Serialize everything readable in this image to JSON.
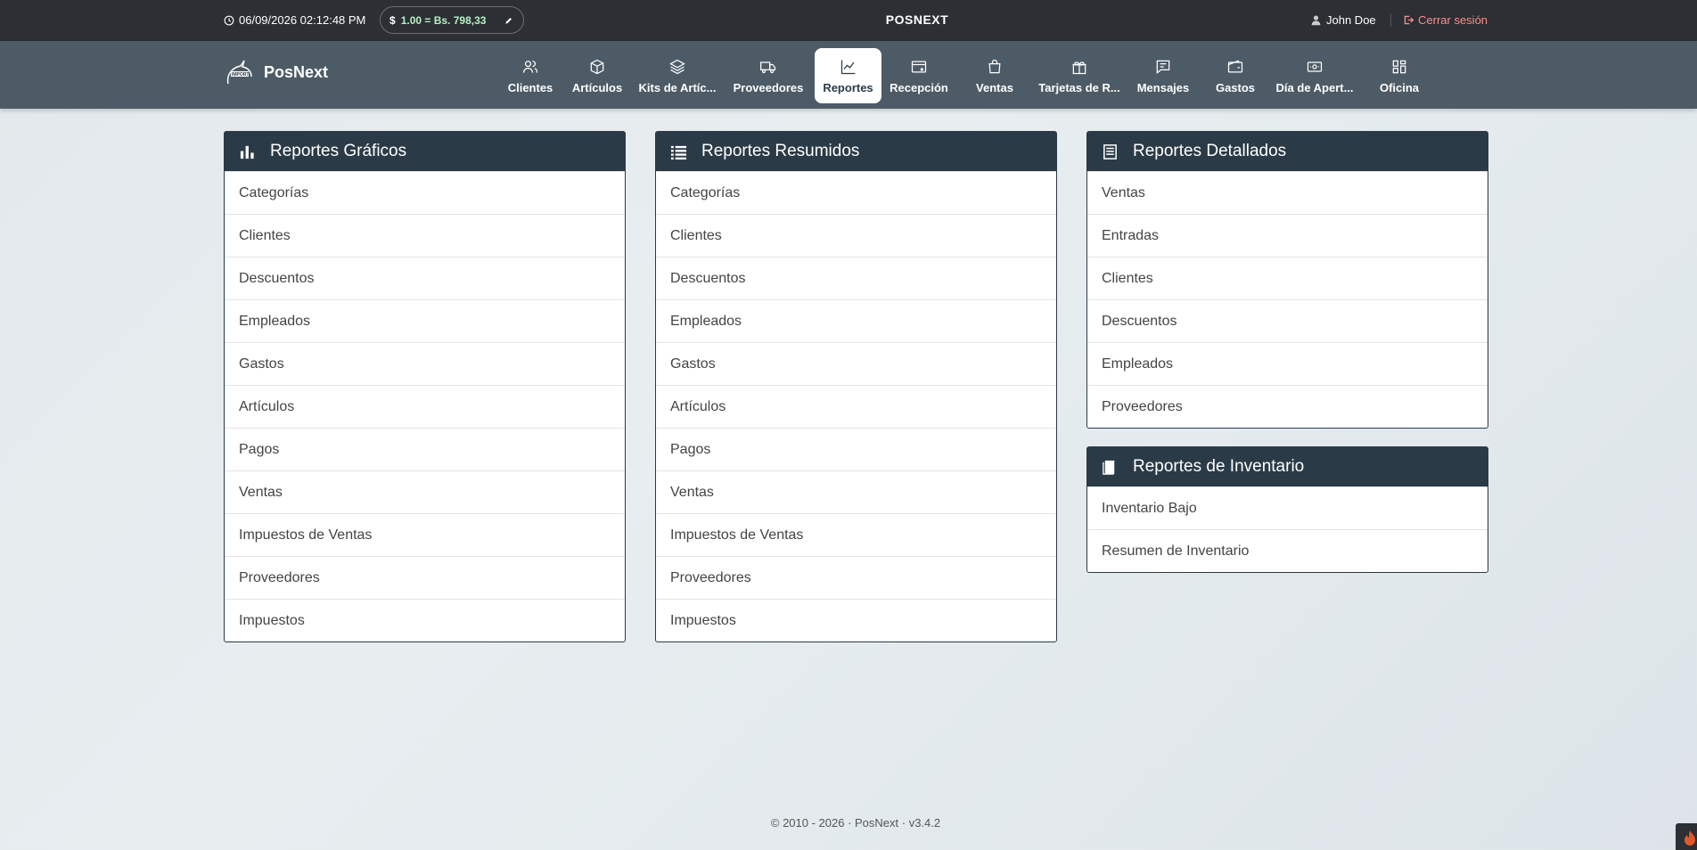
{
  "topbar": {
    "datetime": "06/09/2026 02:12:48 PM",
    "currency_symbol": "$",
    "exchange_rate": "1.00 = Bs. 798,33",
    "brand": "POSNEXT",
    "user_name": "John Doe",
    "logout_label": "Cerrar sesión"
  },
  "navbar": {
    "logo_text": "PosNext",
    "items": [
      {
        "label": "Clientes",
        "icon": "users-icon"
      },
      {
        "label": "Artículos",
        "icon": "box-icon"
      },
      {
        "label": "Kits de Artíc...",
        "icon": "layers-icon"
      },
      {
        "label": "Proveedores",
        "icon": "truck-icon"
      },
      {
        "label": "Reportes",
        "icon": "chart-line-icon",
        "active": true
      },
      {
        "label": "Recepción",
        "icon": "inbox-icon"
      },
      {
        "label": "Ventas",
        "icon": "shopping-bag-icon"
      },
      {
        "label": "Tarjetas de R...",
        "icon": "gift-icon"
      },
      {
        "label": "Mensajes",
        "icon": "message-icon"
      },
      {
        "label": "Gastos",
        "icon": "wallet-icon"
      },
      {
        "label": "Día de Apert...",
        "icon": "cash-icon"
      },
      {
        "label": "Oficina",
        "icon": "grid-icon"
      }
    ]
  },
  "panels": {
    "graficos": {
      "title": "Reportes Gráficos",
      "icon": "bar-chart-icon",
      "items": [
        "Categorías",
        "Clientes",
        "Descuentos",
        "Empleados",
        "Gastos",
        "Artículos",
        "Pagos",
        "Ventas",
        "Impuestos de Ventas",
        "Proveedores",
        "Impuestos"
      ]
    },
    "resumidos": {
      "title": "Reportes Resumidos",
      "icon": "list-icon",
      "items": [
        "Categorías",
        "Clientes",
        "Descuentos",
        "Empleados",
        "Gastos",
        "Artículos",
        "Pagos",
        "Ventas",
        "Impuestos de Ventas",
        "Proveedores",
        "Impuestos"
      ]
    },
    "detallados": {
      "title": "Reportes Detallados",
      "icon": "document-list-icon",
      "items": [
        "Ventas",
        "Entradas",
        "Clientes",
        "Descuentos",
        "Empleados",
        "Proveedores"
      ]
    },
    "inventario": {
      "title": "Reportes de Inventario",
      "icon": "book-icon",
      "items": [
        "Inventario Bajo",
        "Resumen de Inventario"
      ]
    }
  },
  "footer": {
    "text": "© 2010 - 2026 · PosNext · v3.4.2"
  },
  "colors": {
    "topbar_bg": "#2c2f33",
    "navbar_bg": "#4d5b66",
    "panel_header_bg": "#2b3a47",
    "logout": "#ff8d8d"
  }
}
